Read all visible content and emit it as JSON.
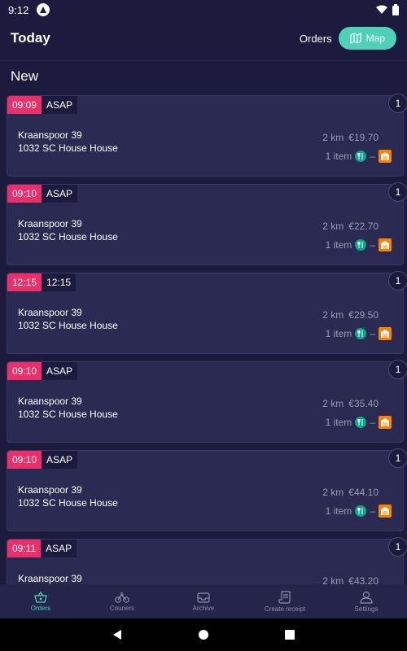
{
  "status": {
    "time": "9:12"
  },
  "header": {
    "title": "Today",
    "orders_link": "Orders",
    "map_button": "Map"
  },
  "section_title": "New",
  "orders": [
    {
      "time": "09:09",
      "schedule": "ASAP",
      "count": "1",
      "street": "Kraanspoor 39",
      "city": "1032 SC House House",
      "distance": "2 km",
      "price": "€19.70",
      "items": "1 item",
      "dash": "–"
    },
    {
      "time": "09:10",
      "schedule": "ASAP",
      "count": "1",
      "street": "Kraanspoor 39",
      "city": "1032 SC House House",
      "distance": "2 km",
      "price": "€22.70",
      "items": "1 item",
      "dash": "–"
    },
    {
      "time": "12:15",
      "schedule": "12:15",
      "count": "1",
      "street": "Kraanspoor 39",
      "city": "1032 SC House House",
      "distance": "2 km",
      "price": "€29.50",
      "items": "1 item",
      "dash": "–"
    },
    {
      "time": "09:10",
      "schedule": "ASAP",
      "count": "1",
      "street": "Kraanspoor 39",
      "city": "1032 SC House House",
      "distance": "2 km",
      "price": "€35.40",
      "items": "1 item",
      "dash": "–"
    },
    {
      "time": "09:10",
      "schedule": "ASAP",
      "count": "1",
      "street": "Kraanspoor 39",
      "city": "1032 SC House House",
      "distance": "2 km",
      "price": "€44.10",
      "items": "1 item",
      "dash": "–"
    },
    {
      "time": "09:11",
      "schedule": "ASAP",
      "count": "1",
      "street": "Kraanspoor 39",
      "city": "",
      "distance": "2 km",
      "price": "€43.20",
      "items": "",
      "dash": ""
    }
  ],
  "bottom_nav": [
    {
      "label": "Orders",
      "icon": "basket-icon",
      "active": true
    },
    {
      "label": "Couriers",
      "icon": "bicycle-icon",
      "active": false
    },
    {
      "label": "Archive",
      "icon": "archive-icon",
      "active": false
    },
    {
      "label": "Create receipt",
      "icon": "receipt-icon",
      "active": false
    },
    {
      "label": "Settings",
      "icon": "user-icon",
      "active": false
    }
  ],
  "colors": {
    "background": "#1c1b3d",
    "card": "#2b2a52",
    "accent": "#4fd1b7",
    "time_tag": "#ec2e6b",
    "platform": "#ff8000"
  }
}
